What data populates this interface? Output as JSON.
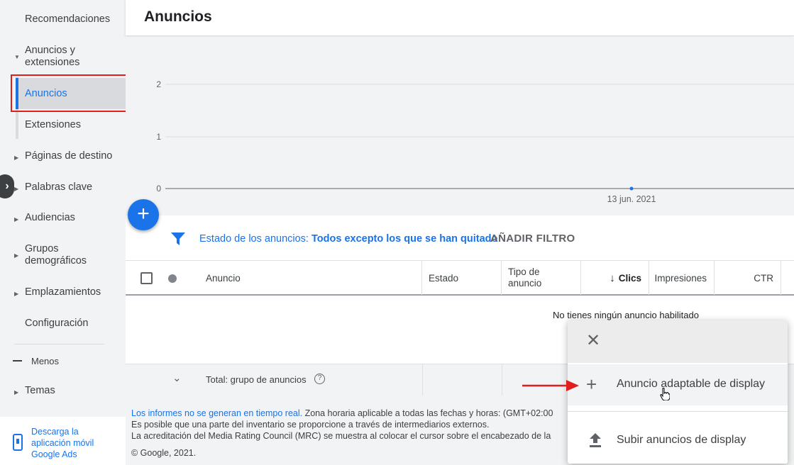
{
  "sidebar": {
    "items": [
      {
        "label": "Recomendaciones"
      },
      {
        "label": "Anuncios y extensiones"
      },
      {
        "label": "Anuncios"
      },
      {
        "label": "Extensiones"
      },
      {
        "label": "Páginas de destino"
      },
      {
        "label": "Palabras clave"
      },
      {
        "label": "Audiencias"
      },
      {
        "label": "Grupos demográficos"
      },
      {
        "label": "Emplazamientos"
      },
      {
        "label": "Configuración"
      },
      {
        "label": "Menos"
      },
      {
        "label": "Temas"
      }
    ],
    "app_promo": "Descarga la aplicación móvil Google Ads"
  },
  "header": {
    "title": "Anuncios"
  },
  "chart": {
    "y_ticks": [
      "2",
      "1",
      "0"
    ],
    "x_label": "13 jun. 2021"
  },
  "filter": {
    "label": "Estado de los anuncios:",
    "value": "Todos excepto los que se han quitado",
    "add_filter": "AÑADIR FILTRO"
  },
  "table": {
    "columns": [
      "Anuncio",
      "Estado",
      "Tipo de anuncio",
      "Clics",
      "Impresiones",
      "CTR"
    ],
    "empty_message": "No tienes ningún anuncio habilitado",
    "total_label": "Total: grupo de anuncios"
  },
  "footer": {
    "link": "Los informes no se generan en tiempo real.",
    "line1_rest": " Zona horaria aplicable a todas las fechas y horas: (GMT+02:00",
    "line2": "Es posible que una parte del inventario se proporcione a través de intermediarios externos.",
    "line3": "La acreditación del Media Rating Council (MRC) se muestra al colocar el cursor sobre el encabezado de la",
    "copyright": "© Google, 2021."
  },
  "popup": {
    "items": [
      {
        "label": "Anuncio adaptable de display",
        "icon": "plus-icon"
      },
      {
        "label": "Subir anuncios de display",
        "icon": "upload-icon"
      }
    ]
  },
  "colors": {
    "accent": "#1a73e8",
    "annotation": "#e01e1e"
  }
}
